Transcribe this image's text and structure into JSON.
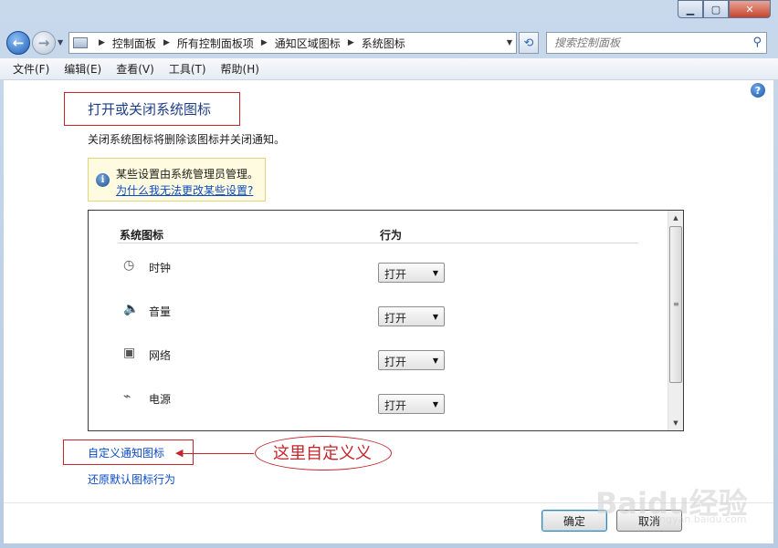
{
  "window": {
    "faded_title": "",
    "controls": {
      "minimize": "▁",
      "maximize": "▢",
      "close": "✕"
    }
  },
  "navigation": {
    "back_glyph": "←",
    "forward_glyph": "→",
    "breadcrumbs": [
      "控制面板",
      "所有控制面板项",
      "通知区域图标",
      "系统图标"
    ],
    "refresh_glyph": "⟲",
    "search_placeholder": "搜索控制面板"
  },
  "menubar": {
    "items": [
      "文件(F)",
      "编辑(E)",
      "查看(V)",
      "工具(T)",
      "帮助(H)"
    ]
  },
  "page": {
    "title": "打开或关闭系统图标",
    "description": "关闭系统图标将删除该图标并关闭通知。",
    "notice": {
      "text": "某些设置由系统管理员管理。",
      "link": "为什么我无法更改某些设置?"
    },
    "table": {
      "columns": [
        "系统图标",
        "行为"
      ],
      "rows": [
        {
          "icon": "clock-icon",
          "label": "时钟",
          "behavior": "打开"
        },
        {
          "icon": "volume-icon",
          "label": "音量",
          "behavior": "打开"
        },
        {
          "icon": "network-icon",
          "label": "网络",
          "behavior": "打开"
        },
        {
          "icon": "power-icon",
          "label": "电源",
          "behavior": "打开"
        }
      ]
    },
    "links": {
      "customize": "自定义通知图标",
      "restore": "还原默认图标行为"
    },
    "annotation": "这里自定义义",
    "buttons": {
      "ok": "确定",
      "cancel": "取消"
    }
  },
  "watermark": {
    "brand": "Baidu经验",
    "sub": "jingyan.baidu.com"
  },
  "colors": {
    "accent": "#1e3f85",
    "link": "#0b4bc4",
    "annotation": "#c4252b"
  }
}
